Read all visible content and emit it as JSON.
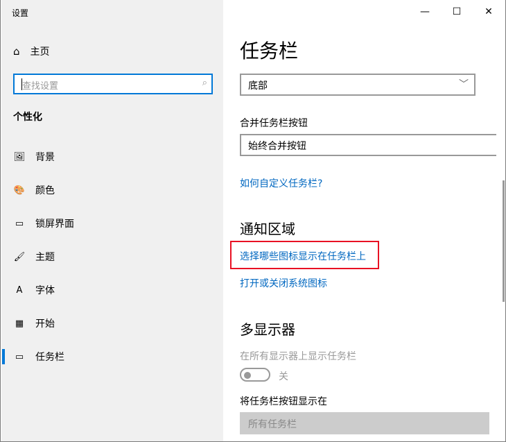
{
  "window": {
    "title": "设置",
    "minimize": "—",
    "maximize": "☐",
    "close": "✕"
  },
  "sidebar": {
    "home": "主页",
    "home_icon": "home-icon",
    "search_placeholder": "查找设置",
    "search_icon": "search-icon",
    "section": "个性化",
    "items": [
      {
        "label": "背景",
        "icon": "🖼"
      },
      {
        "label": "颜色",
        "icon": "🎨"
      },
      {
        "label": "锁屏界面",
        "icon": "▭"
      },
      {
        "label": "主题",
        "icon": "🖌"
      },
      {
        "label": "字体",
        "icon": "A"
      },
      {
        "label": "开始",
        "icon": "▦"
      },
      {
        "label": "任务栏",
        "icon": "▭",
        "selected": true
      }
    ]
  },
  "main": {
    "title": "任务栏",
    "position_value": "底部",
    "combine_label": "合并任务栏按钮",
    "combine_value": "始终合并按钮",
    "customize_link": "如何自定义任务栏?",
    "notify_heading": "通知区域",
    "notify_link1": "选择哪些图标显示在任务栏上",
    "notify_link2": "打开或关闭系统图标",
    "multi_heading": "多显示器",
    "multi_show_label": "在所有显示器上显示任务栏",
    "multi_toggle_state": "关",
    "multi_buttons_label": "将任务栏按钮显示在",
    "multi_buttons_value": "所有任务栏"
  },
  "colors": {
    "accent": "#0078d7",
    "link": "#0067c0",
    "highlight": "#e81123"
  }
}
